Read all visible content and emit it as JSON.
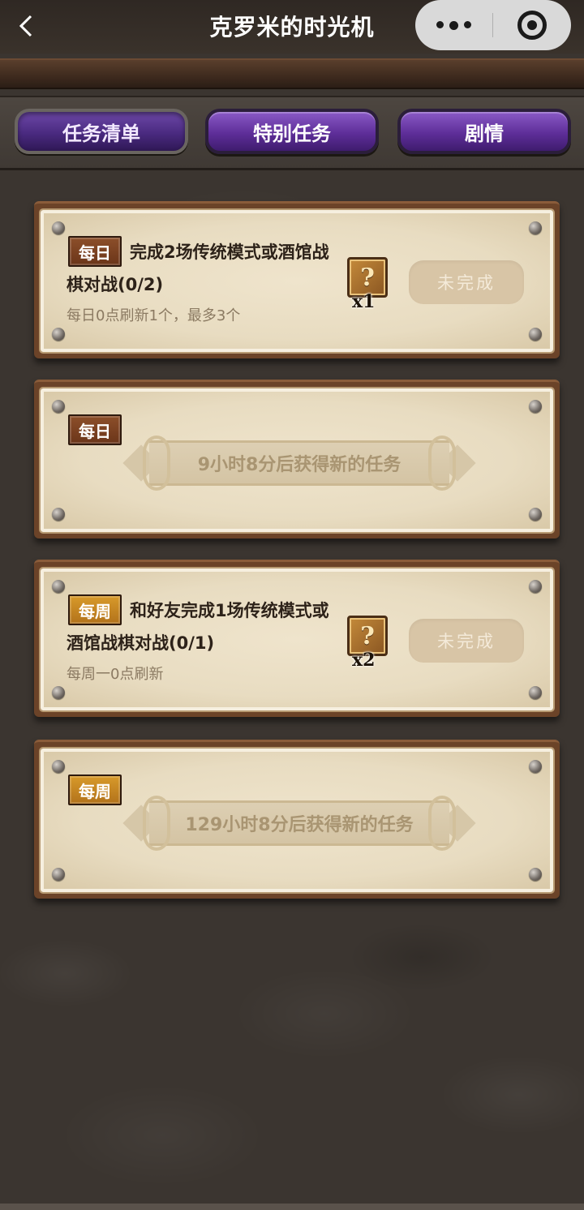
{
  "header": {
    "title": "克罗米的时光机",
    "back_icon": "chevron-left-icon",
    "more_icon": "more-dots-icon",
    "close_icon": "target-icon"
  },
  "tabs": [
    {
      "label": "任务清单",
      "active": true
    },
    {
      "label": "特别任务",
      "active": false
    },
    {
      "label": "剧情",
      "active": false
    }
  ],
  "cards": [
    {
      "badge": "每日",
      "type": "task",
      "title": "完成2场传统模式或酒馆战棋对战(0/2)",
      "note": "每日0点刷新1个，最多3个",
      "reward_icon": "mystery-box-icon",
      "reward_count": "x1",
      "status": "未完成"
    },
    {
      "badge": "每日",
      "type": "pending",
      "message": "9小时8分后获得新的任务"
    },
    {
      "badge": "每周",
      "type": "task",
      "title": "和好友完成1场传统模式或酒馆战棋对战(0/1)",
      "note": "每周一0点刷新",
      "reward_icon": "mystery-box-icon",
      "reward_count": "x2",
      "status": "未完成"
    },
    {
      "badge": "每周",
      "type": "pending",
      "message": "129小时8分后获得新的任务"
    }
  ],
  "colors": {
    "background": "#3b3530",
    "tab_purple": "#5e2e99",
    "card_frame": "#6b4328",
    "parchment": "#efe4cc",
    "badge_daily": "#8c4f2a",
    "badge_weekly": "#d89a2a"
  }
}
